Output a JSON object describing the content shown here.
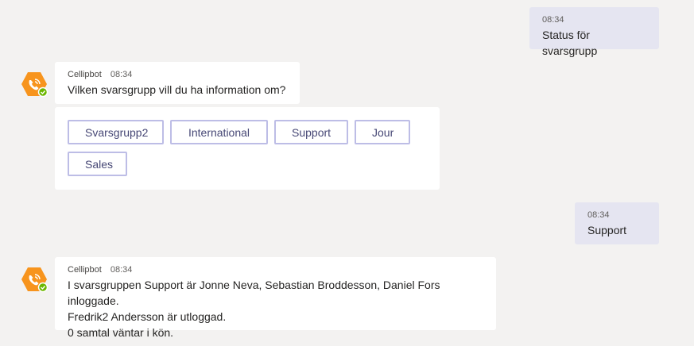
{
  "conversation": {
    "outgoing1": {
      "time": "08:34",
      "text": "Status för svarsgrupp"
    },
    "bot1": {
      "name": "Cellipbot",
      "time": "08:34",
      "text": "Vilken svarsgrupp vill du ha information om?",
      "buttons": [
        "Svarsgrupp2",
        "International",
        "Support",
        "Jour",
        "Sales"
      ]
    },
    "outgoing2": {
      "time": "08:34",
      "text": "Support"
    },
    "bot2": {
      "name": "Cellipbot",
      "time": "08:34",
      "lines": [
        "I svarsgruppen Support är Jonne Neva, Sebastian Broddesson, Daniel Fors inloggade.",
        "Fredrik2 Andersson är utloggad.",
        "0 samtal väntar i kön."
      ]
    }
  },
  "colors": {
    "background": "#f3f2f1",
    "outgoing_bubble": "#e5e5f1",
    "button_border": "#bdbde6",
    "button_text": "#464775",
    "avatar_orange": "#f7941d",
    "online_green": "#6bb700"
  },
  "icons": {
    "avatar": "phone-hexagon-icon",
    "status": "available-check-icon"
  }
}
